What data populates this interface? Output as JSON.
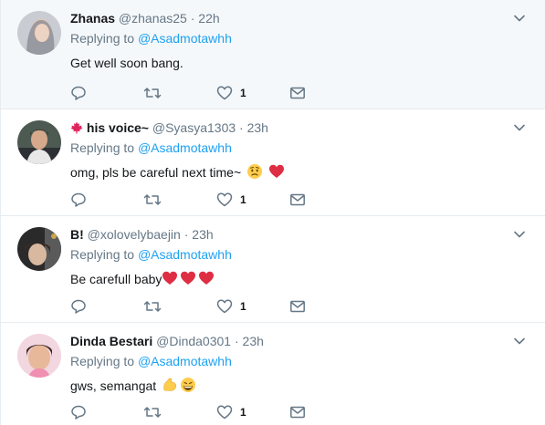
{
  "tweets": [
    {
      "name": "Zhanas",
      "handle": "@zhanas25",
      "time": "22h",
      "replying_label": "Replying to",
      "mention": "@Asadmotawhh",
      "text": "Get well soon bang.",
      "likes": "1"
    },
    {
      "name": "his voice~",
      "handle": "@Syasya1303",
      "time": "23h",
      "replying_label": "Replying to",
      "mention": "@Asadmotawhh",
      "text": "omg, pls be careful next time~",
      "likes": "1"
    },
    {
      "name": "B!",
      "handle": "@xolovelybaejin",
      "time": "23h",
      "replying_label": "Replying to",
      "mention": "@Asadmotawhh",
      "text": "Be carefull baby",
      "likes": "1"
    },
    {
      "name": "Dinda Bestari",
      "handle": "@Dinda0301",
      "time": "23h",
      "replying_label": "Replying to",
      "mention": "@Asadmotawhh",
      "text": "gws, semangat",
      "likes": "1"
    }
  ],
  "separator": "·",
  "colors": {
    "link": "#1da1f2",
    "muted": "#657786",
    "heart": "#e0245e",
    "highlight_bg": "#f5f8fa"
  }
}
